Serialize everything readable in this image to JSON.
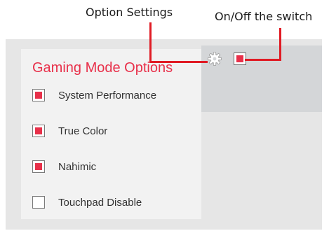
{
  "callouts": {
    "option_settings": "Option Settings",
    "on_off": "On/Off the switch"
  },
  "panel": {
    "title": "Gaming Mode Options"
  },
  "switch": {
    "on": true
  },
  "options": [
    {
      "label": "System Performance",
      "checked": true
    },
    {
      "label": "True Color",
      "checked": true
    },
    {
      "label": "Nahimic",
      "checked": true
    },
    {
      "label": "Touchpad Disable",
      "checked": false
    }
  ],
  "colors": {
    "accent": "#e8304a",
    "callout_line": "#e01b24",
    "outer_panel": "#e6e6e6",
    "inner_panel": "#f2f2f2",
    "top_strip": "#d4d6d8"
  },
  "icons": {
    "settings": "gear-icon",
    "switch": "switch-checkbox"
  }
}
